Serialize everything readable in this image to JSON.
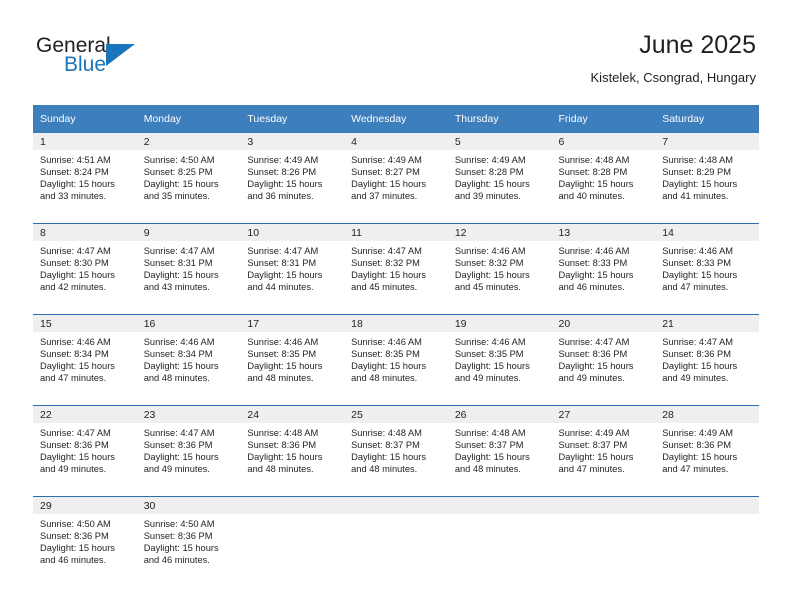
{
  "brand": {
    "name_part1": "General",
    "name_part2": "Blue",
    "flag_icon": "triangle-flag-icon"
  },
  "header": {
    "title": "June 2025",
    "location": "Kistelek, Csongrad, Hungary"
  },
  "colors": {
    "header_blue": "#3d7ebc",
    "separator_blue": "#2a6db0",
    "daynum_band": "#efefef",
    "brand_blue": "#1b75bb",
    "text": "#231f20"
  },
  "weekday_headers": [
    "Sunday",
    "Monday",
    "Tuesday",
    "Wednesday",
    "Thursday",
    "Friday",
    "Saturday"
  ],
  "weeks": [
    [
      {
        "day": "1",
        "sunrise": "Sunrise: 4:51 AM",
        "sunset": "Sunset: 8:24 PM",
        "daylight_line1": "Daylight: 15 hours",
        "daylight_line2": "and 33 minutes."
      },
      {
        "day": "2",
        "sunrise": "Sunrise: 4:50 AM",
        "sunset": "Sunset: 8:25 PM",
        "daylight_line1": "Daylight: 15 hours",
        "daylight_line2": "and 35 minutes."
      },
      {
        "day": "3",
        "sunrise": "Sunrise: 4:49 AM",
        "sunset": "Sunset: 8:26 PM",
        "daylight_line1": "Daylight: 15 hours",
        "daylight_line2": "and 36 minutes."
      },
      {
        "day": "4",
        "sunrise": "Sunrise: 4:49 AM",
        "sunset": "Sunset: 8:27 PM",
        "daylight_line1": "Daylight: 15 hours",
        "daylight_line2": "and 37 minutes."
      },
      {
        "day": "5",
        "sunrise": "Sunrise: 4:49 AM",
        "sunset": "Sunset: 8:28 PM",
        "daylight_line1": "Daylight: 15 hours",
        "daylight_line2": "and 39 minutes."
      },
      {
        "day": "6",
        "sunrise": "Sunrise: 4:48 AM",
        "sunset": "Sunset: 8:28 PM",
        "daylight_line1": "Daylight: 15 hours",
        "daylight_line2": "and 40 minutes."
      },
      {
        "day": "7",
        "sunrise": "Sunrise: 4:48 AM",
        "sunset": "Sunset: 8:29 PM",
        "daylight_line1": "Daylight: 15 hours",
        "daylight_line2": "and 41 minutes."
      }
    ],
    [
      {
        "day": "8",
        "sunrise": "Sunrise: 4:47 AM",
        "sunset": "Sunset: 8:30 PM",
        "daylight_line1": "Daylight: 15 hours",
        "daylight_line2": "and 42 minutes."
      },
      {
        "day": "9",
        "sunrise": "Sunrise: 4:47 AM",
        "sunset": "Sunset: 8:31 PM",
        "daylight_line1": "Daylight: 15 hours",
        "daylight_line2": "and 43 minutes."
      },
      {
        "day": "10",
        "sunrise": "Sunrise: 4:47 AM",
        "sunset": "Sunset: 8:31 PM",
        "daylight_line1": "Daylight: 15 hours",
        "daylight_line2": "and 44 minutes."
      },
      {
        "day": "11",
        "sunrise": "Sunrise: 4:47 AM",
        "sunset": "Sunset: 8:32 PM",
        "daylight_line1": "Daylight: 15 hours",
        "daylight_line2": "and 45 minutes."
      },
      {
        "day": "12",
        "sunrise": "Sunrise: 4:46 AM",
        "sunset": "Sunset: 8:32 PM",
        "daylight_line1": "Daylight: 15 hours",
        "daylight_line2": "and 45 minutes."
      },
      {
        "day": "13",
        "sunrise": "Sunrise: 4:46 AM",
        "sunset": "Sunset: 8:33 PM",
        "daylight_line1": "Daylight: 15 hours",
        "daylight_line2": "and 46 minutes."
      },
      {
        "day": "14",
        "sunrise": "Sunrise: 4:46 AM",
        "sunset": "Sunset: 8:33 PM",
        "daylight_line1": "Daylight: 15 hours",
        "daylight_line2": "and 47 minutes."
      }
    ],
    [
      {
        "day": "15",
        "sunrise": "Sunrise: 4:46 AM",
        "sunset": "Sunset: 8:34 PM",
        "daylight_line1": "Daylight: 15 hours",
        "daylight_line2": "and 47 minutes."
      },
      {
        "day": "16",
        "sunrise": "Sunrise: 4:46 AM",
        "sunset": "Sunset: 8:34 PM",
        "daylight_line1": "Daylight: 15 hours",
        "daylight_line2": "and 48 minutes."
      },
      {
        "day": "17",
        "sunrise": "Sunrise: 4:46 AM",
        "sunset": "Sunset: 8:35 PM",
        "daylight_line1": "Daylight: 15 hours",
        "daylight_line2": "and 48 minutes."
      },
      {
        "day": "18",
        "sunrise": "Sunrise: 4:46 AM",
        "sunset": "Sunset: 8:35 PM",
        "daylight_line1": "Daylight: 15 hours",
        "daylight_line2": "and 48 minutes."
      },
      {
        "day": "19",
        "sunrise": "Sunrise: 4:46 AM",
        "sunset": "Sunset: 8:35 PM",
        "daylight_line1": "Daylight: 15 hours",
        "daylight_line2": "and 49 minutes."
      },
      {
        "day": "20",
        "sunrise": "Sunrise: 4:47 AM",
        "sunset": "Sunset: 8:36 PM",
        "daylight_line1": "Daylight: 15 hours",
        "daylight_line2": "and 49 minutes."
      },
      {
        "day": "21",
        "sunrise": "Sunrise: 4:47 AM",
        "sunset": "Sunset: 8:36 PM",
        "daylight_line1": "Daylight: 15 hours",
        "daylight_line2": "and 49 minutes."
      }
    ],
    [
      {
        "day": "22",
        "sunrise": "Sunrise: 4:47 AM",
        "sunset": "Sunset: 8:36 PM",
        "daylight_line1": "Daylight: 15 hours",
        "daylight_line2": "and 49 minutes."
      },
      {
        "day": "23",
        "sunrise": "Sunrise: 4:47 AM",
        "sunset": "Sunset: 8:36 PM",
        "daylight_line1": "Daylight: 15 hours",
        "daylight_line2": "and 49 minutes."
      },
      {
        "day": "24",
        "sunrise": "Sunrise: 4:48 AM",
        "sunset": "Sunset: 8:36 PM",
        "daylight_line1": "Daylight: 15 hours",
        "daylight_line2": "and 48 minutes."
      },
      {
        "day": "25",
        "sunrise": "Sunrise: 4:48 AM",
        "sunset": "Sunset: 8:37 PM",
        "daylight_line1": "Daylight: 15 hours",
        "daylight_line2": "and 48 minutes."
      },
      {
        "day": "26",
        "sunrise": "Sunrise: 4:48 AM",
        "sunset": "Sunset: 8:37 PM",
        "daylight_line1": "Daylight: 15 hours",
        "daylight_line2": "and 48 minutes."
      },
      {
        "day": "27",
        "sunrise": "Sunrise: 4:49 AM",
        "sunset": "Sunset: 8:37 PM",
        "daylight_line1": "Daylight: 15 hours",
        "daylight_line2": "and 47 minutes."
      },
      {
        "day": "28",
        "sunrise": "Sunrise: 4:49 AM",
        "sunset": "Sunset: 8:36 PM",
        "daylight_line1": "Daylight: 15 hours",
        "daylight_line2": "and 47 minutes."
      }
    ],
    [
      {
        "day": "29",
        "sunrise": "Sunrise: 4:50 AM",
        "sunset": "Sunset: 8:36 PM",
        "daylight_line1": "Daylight: 15 hours",
        "daylight_line2": "and 46 minutes."
      },
      {
        "day": "30",
        "sunrise": "Sunrise: 4:50 AM",
        "sunset": "Sunset: 8:36 PM",
        "daylight_line1": "Daylight: 15 hours",
        "daylight_line2": "and 46 minutes."
      },
      {
        "day": "",
        "sunrise": "",
        "sunset": "",
        "daylight_line1": "",
        "daylight_line2": ""
      },
      {
        "day": "",
        "sunrise": "",
        "sunset": "",
        "daylight_line1": "",
        "daylight_line2": ""
      },
      {
        "day": "",
        "sunrise": "",
        "sunset": "",
        "daylight_line1": "",
        "daylight_line2": ""
      },
      {
        "day": "",
        "sunrise": "",
        "sunset": "",
        "daylight_line1": "",
        "daylight_line2": ""
      },
      {
        "day": "",
        "sunrise": "",
        "sunset": "",
        "daylight_line1": "",
        "daylight_line2": ""
      }
    ]
  ]
}
